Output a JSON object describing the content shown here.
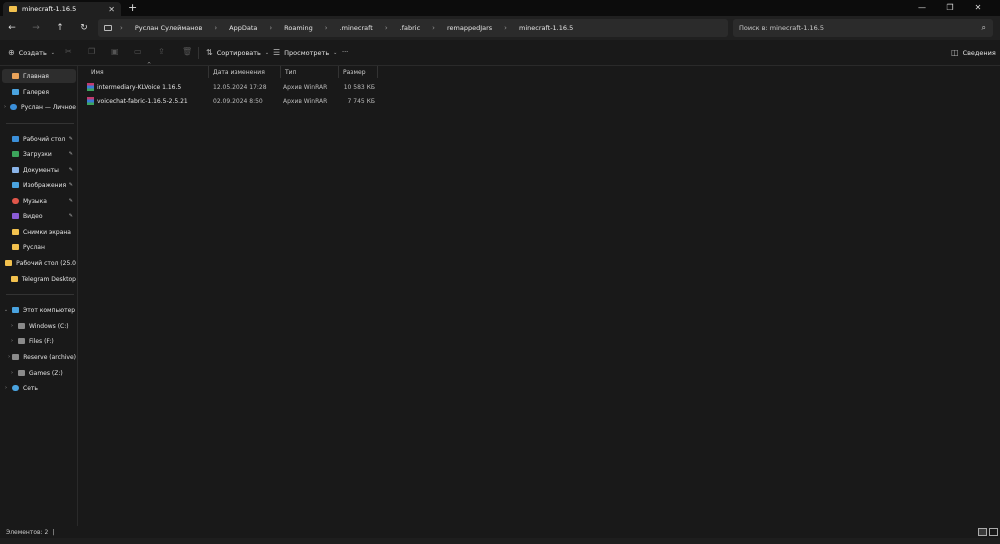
{
  "window": {
    "tab_title": "minecraft-1.16.5",
    "new_tab": "+",
    "tab_close": "✕",
    "minimize": "—",
    "maximize": "❐",
    "close": "✕"
  },
  "nav": {
    "back": "←",
    "forward": "→",
    "up": "↑",
    "refresh": "↻",
    "breadcrumbs": [
      "Руслан Сулейманов",
      "AppData",
      "Roaming",
      ".minecraft",
      ".fabric",
      "remappedJars",
      "minecraft-1.16.5"
    ],
    "search_placeholder": "Поиск в: minecraft-1.16.5"
  },
  "toolbar": {
    "create": "Создать",
    "sort": "Сортировать",
    "view": "Просмотреть",
    "more": "···",
    "details": "Сведения"
  },
  "sidebar": {
    "home": "Главная",
    "gallery": "Галерея",
    "onedrive": "Руслан — Личное",
    "quick": [
      {
        "label": "Рабочий стол",
        "color": "#3b8fd9",
        "pinned": true
      },
      {
        "label": "Загрузки",
        "color": "#3ca55c",
        "pinned": true
      },
      {
        "label": "Документы",
        "color": "#8ab4e8",
        "pinned": true
      },
      {
        "label": "Изображения",
        "color": "#4aa3df",
        "pinned": true
      },
      {
        "label": "Музыка",
        "color": "#e0564a",
        "pinned": true
      },
      {
        "label": "Видео",
        "color": "#8a5cd6",
        "pinned": true
      },
      {
        "label": "Снимки экрана",
        "color": "#f2c14e",
        "pinned": false
      },
      {
        "label": "Руслан",
        "color": "#f2c14e",
        "pinned": false
      },
      {
        "label": "Рабочий стол (25.0",
        "color": "#f2c14e",
        "pinned": false
      },
      {
        "label": "Telegram Desktop",
        "color": "#f2c14e",
        "pinned": false
      }
    ],
    "this_pc": "Этот компьютер",
    "drives": [
      "Windows (C:)",
      "Files (F:)",
      "Reserve (archive)",
      "Games (Z:)"
    ],
    "network": "Сеть"
  },
  "columns": {
    "name": "Имя",
    "date": "Дата изменения",
    "type": "Тип",
    "size": "Размер"
  },
  "files": [
    {
      "name": "intermediary-KLVoice 1.16.5",
      "date": "12.05.2024 17:28",
      "type": "Архив WinRAR",
      "size": "10 583 КБ"
    },
    {
      "name": "voicechat-fabric-1.16.5-2.5.21",
      "date": "02.09.2024 8:50",
      "type": "Архив WinRAR",
      "size": "7 745 КБ"
    }
  ],
  "status": {
    "items": "Элементов: 2",
    "sep": "|"
  }
}
